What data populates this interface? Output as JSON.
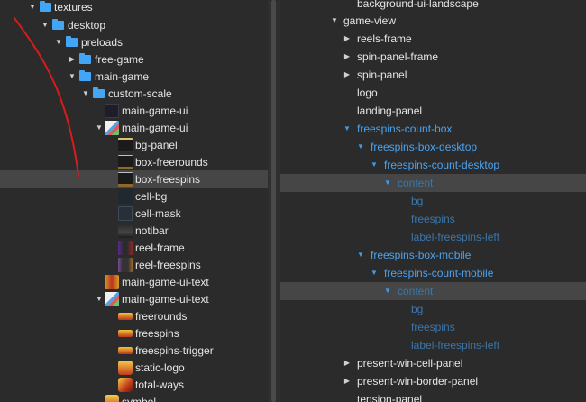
{
  "left_tree": {
    "items": [
      {
        "label": "textures",
        "icon": "folder-icon",
        "expanded": true
      },
      {
        "label": "desktop",
        "icon": "folder-icon",
        "expanded": true
      },
      {
        "label": "preloads",
        "icon": "folder-icon",
        "expanded": true
      },
      {
        "label": "free-game",
        "icon": "folder-icon",
        "expanded": false
      },
      {
        "label": "main-game",
        "icon": "folder-icon",
        "expanded": true
      },
      {
        "label": "custom-scale",
        "icon": "folder-icon",
        "expanded": true
      },
      {
        "label": "main-game-ui",
        "icon": "image-thumbnail"
      },
      {
        "label": "main-game-ui",
        "icon": "spritesheet-icon",
        "expanded": true
      },
      {
        "label": "bg-panel",
        "icon": "image-thumbnail"
      },
      {
        "label": "box-freerounds",
        "icon": "image-thumbnail"
      },
      {
        "label": "box-freespins",
        "icon": "image-thumbnail",
        "selected": true
      },
      {
        "label": "cell-bg",
        "icon": "image-thumbnail"
      },
      {
        "label": "cell-mask",
        "icon": "image-thumbnail"
      },
      {
        "label": "notibar",
        "icon": "image-thumbnail"
      },
      {
        "label": "reel-frame",
        "icon": "image-thumbnail"
      },
      {
        "label": "reel-freespins",
        "icon": "image-thumbnail"
      },
      {
        "label": "main-game-ui-text",
        "icon": "image-thumbnail"
      },
      {
        "label": "main-game-ui-text",
        "icon": "spritesheet-icon",
        "expanded": true
      },
      {
        "label": "freerounds",
        "icon": "image-thumbnail"
      },
      {
        "label": "freespins",
        "icon": "image-thumbnail"
      },
      {
        "label": "freespins-trigger",
        "icon": "image-thumbnail"
      },
      {
        "label": "static-logo",
        "icon": "image-thumbnail"
      },
      {
        "label": "total-ways",
        "icon": "image-thumbnail"
      },
      {
        "label": "symbol",
        "icon": "image-thumbnail"
      }
    ]
  },
  "right_tree": {
    "items": [
      {
        "label": "background-ui-landscape"
      },
      {
        "label": "game-view",
        "expanded": true
      },
      {
        "label": "reels-frame",
        "expanded": false
      },
      {
        "label": "spin-panel-frame",
        "expanded": false
      },
      {
        "label": "spin-panel",
        "expanded": false
      },
      {
        "label": "logo"
      },
      {
        "label": "landing-panel"
      },
      {
        "label": "freespins-count-box",
        "expanded": true,
        "color": "#4aa3f0"
      },
      {
        "label": "freespins-box-desktop",
        "expanded": true,
        "color": "#4aa3f0"
      },
      {
        "label": "freespins-count-desktop",
        "expanded": true,
        "color": "#4aa3f0"
      },
      {
        "label": "content",
        "expanded": true,
        "selected": true,
        "color": "#3a77ad"
      },
      {
        "label": "bg",
        "color": "#3a77ad"
      },
      {
        "label": "freespins",
        "color": "#3a77ad"
      },
      {
        "label": "label-freespins-left",
        "color": "#3a77ad"
      },
      {
        "label": "freespins-box-mobile",
        "expanded": true,
        "color": "#4aa3f0"
      },
      {
        "label": "freespins-count-mobile",
        "expanded": true,
        "color": "#4aa3f0"
      },
      {
        "label": "content",
        "expanded": true,
        "selected": true,
        "color": "#3a77ad"
      },
      {
        "label": "bg",
        "color": "#3a77ad"
      },
      {
        "label": "freespins",
        "color": "#3a77ad"
      },
      {
        "label": "label-freespins-left",
        "color": "#3a77ad"
      },
      {
        "label": "present-win-cell-panel",
        "expanded": false
      },
      {
        "label": "present-win-border-panel",
        "expanded": false
      },
      {
        "label": "tension-panel"
      }
    ]
  },
  "colors": {
    "background": "#2b2b2b",
    "selection": "#464646",
    "active_blue": "#4aa3f0",
    "dim_blue": "#3a77ad",
    "folder": "#42a5f5",
    "annotation_stroke": "#d81b1b"
  }
}
